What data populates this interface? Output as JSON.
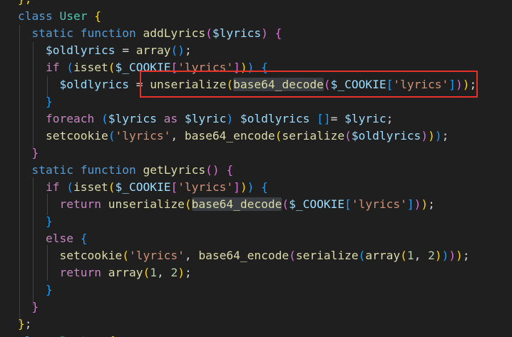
{
  "code_lines": [
    [
      {
        "t": "};",
        "c": "b1"
      }
    ],
    [
      {
        "t": "class ",
        "c": "kw"
      },
      {
        "t": "User ",
        "c": "cls"
      },
      {
        "t": "{",
        "c": "b1"
      }
    ],
    [
      {
        "t": "  "
      },
      {
        "t": "static ",
        "c": "kw"
      },
      {
        "t": "function ",
        "c": "kw"
      },
      {
        "t": "addLyrics",
        "c": "fn"
      },
      {
        "t": "(",
        "c": "b2"
      },
      {
        "t": "$lyrics",
        "c": "var"
      },
      {
        "t": ") ",
        "c": "b2"
      },
      {
        "t": "{",
        "c": "b2"
      }
    ],
    [
      {
        "t": "    "
      },
      {
        "t": "$oldlyrics",
        "c": "var"
      },
      {
        "t": " = "
      },
      {
        "t": "array",
        "c": "fn"
      },
      {
        "t": "()",
        "c": "b3"
      },
      {
        "t": ";"
      }
    ],
    [
      {
        "t": "    "
      },
      {
        "t": "if ",
        "c": "ctl"
      },
      {
        "t": "(",
        "c": "b3"
      },
      {
        "t": "isset",
        "c": "fn"
      },
      {
        "t": "(",
        "c": "b1"
      },
      {
        "t": "$_COOKIE",
        "c": "var"
      },
      {
        "t": "[",
        "c": "b2"
      },
      {
        "t": "'lyrics'",
        "c": "str"
      },
      {
        "t": "]",
        "c": "b2"
      },
      {
        "t": ")",
        "c": "b1"
      },
      {
        "t": ") ",
        "c": "b3"
      },
      {
        "t": "{",
        "c": "b3"
      }
    ],
    [
      {
        "t": "      "
      },
      {
        "t": "$oldlyrics",
        "c": "var"
      },
      {
        "t": " = "
      },
      {
        "t": "unserialize",
        "c": "fn"
      },
      {
        "t": "(",
        "c": "b1"
      },
      {
        "t": "base64_decode",
        "c": "fn",
        "hl": true
      },
      {
        "t": "(",
        "c": "b2"
      },
      {
        "t": "$_COOKIE",
        "c": "var"
      },
      {
        "t": "[",
        "c": "b3"
      },
      {
        "t": "'lyrics'",
        "c": "str"
      },
      {
        "t": "]",
        "c": "b3"
      },
      {
        "t": ")",
        "c": "b2"
      },
      {
        "t": ")",
        "c": "b1"
      },
      {
        "t": ";"
      }
    ],
    [
      {
        "t": "    "
      },
      {
        "t": "}",
        "c": "b3"
      }
    ],
    [
      {
        "t": "    "
      },
      {
        "t": "foreach ",
        "c": "ctl"
      },
      {
        "t": "(",
        "c": "b3"
      },
      {
        "t": "$lyrics",
        "c": "var"
      },
      {
        "t": " as ",
        "c": "ctl"
      },
      {
        "t": "$lyric",
        "c": "var"
      },
      {
        "t": ") ",
        "c": "b3"
      },
      {
        "t": "$oldlyrics",
        "c": "var"
      },
      {
        "t": " "
      },
      {
        "t": "[]",
        "c": "b3"
      },
      {
        "t": "= "
      },
      {
        "t": "$lyric",
        "c": "var"
      },
      {
        "t": ";"
      }
    ],
    [
      {
        "t": "    "
      },
      {
        "t": "setcookie",
        "c": "fn"
      },
      {
        "t": "(",
        "c": "b3"
      },
      {
        "t": "'lyrics'",
        "c": "str"
      },
      {
        "t": ", "
      },
      {
        "t": "base64_encode",
        "c": "fn"
      },
      {
        "t": "(",
        "c": "b1"
      },
      {
        "t": "serialize",
        "c": "fn"
      },
      {
        "t": "(",
        "c": "b2"
      },
      {
        "t": "$oldlyrics",
        "c": "var"
      },
      {
        "t": ")",
        "c": "b2"
      },
      {
        "t": ")",
        "c": "b1"
      },
      {
        "t": ")",
        "c": "b3"
      },
      {
        "t": ";"
      }
    ],
    [
      {
        "t": "  "
      },
      {
        "t": "}",
        "c": "b2"
      }
    ],
    [
      {
        "t": "  "
      },
      {
        "t": "static ",
        "c": "kw"
      },
      {
        "t": "function ",
        "c": "kw"
      },
      {
        "t": "getLyrics",
        "c": "fn"
      },
      {
        "t": "() ",
        "c": "b2"
      },
      {
        "t": "{",
        "c": "b2"
      }
    ],
    [
      {
        "t": "    "
      },
      {
        "t": "if ",
        "c": "ctl"
      },
      {
        "t": "(",
        "c": "b3"
      },
      {
        "t": "isset",
        "c": "fn"
      },
      {
        "t": "(",
        "c": "b1"
      },
      {
        "t": "$_COOKIE",
        "c": "var"
      },
      {
        "t": "[",
        "c": "b2"
      },
      {
        "t": "'lyrics'",
        "c": "str"
      },
      {
        "t": "]",
        "c": "b2"
      },
      {
        "t": ")",
        "c": "b1"
      },
      {
        "t": ") ",
        "c": "b3"
      },
      {
        "t": "{",
        "c": "b3"
      }
    ],
    [
      {
        "t": "      "
      },
      {
        "t": "return ",
        "c": "ctl"
      },
      {
        "t": "unserialize",
        "c": "fn"
      },
      {
        "t": "(",
        "c": "b1"
      },
      {
        "t": "base64_decode",
        "c": "fn",
        "hl": true
      },
      {
        "t": "(",
        "c": "b2"
      },
      {
        "t": "$_COOKIE",
        "c": "var"
      },
      {
        "t": "[",
        "c": "b3"
      },
      {
        "t": "'lyrics'",
        "c": "str"
      },
      {
        "t": "]",
        "c": "b3"
      },
      {
        "t": ")",
        "c": "b2"
      },
      {
        "t": ")",
        "c": "b1"
      },
      {
        "t": ";"
      }
    ],
    [
      {
        "t": "    "
      },
      {
        "t": "}",
        "c": "b3"
      }
    ],
    [
      {
        "t": "    "
      },
      {
        "t": "else ",
        "c": "ctl"
      },
      {
        "t": "{",
        "c": "b3"
      }
    ],
    [
      {
        "t": "      "
      },
      {
        "t": "setcookie",
        "c": "fn"
      },
      {
        "t": "(",
        "c": "b1"
      },
      {
        "t": "'lyrics'",
        "c": "str"
      },
      {
        "t": ", "
      },
      {
        "t": "base64_encode",
        "c": "fn"
      },
      {
        "t": "(",
        "c": "b2"
      },
      {
        "t": "serialize",
        "c": "fn"
      },
      {
        "t": "(",
        "c": "b3"
      },
      {
        "t": "array",
        "c": "fn"
      },
      {
        "t": "(",
        "c": "b1"
      },
      {
        "t": "1",
        "c": "num"
      },
      {
        "t": ", "
      },
      {
        "t": "2",
        "c": "num"
      },
      {
        "t": ")",
        "c": "b1"
      },
      {
        "t": ")",
        "c": "b3"
      },
      {
        "t": ")",
        "c": "b2"
      },
      {
        "t": ")",
        "c": "b1"
      },
      {
        "t": ";"
      }
    ],
    [
      {
        "t": "      "
      },
      {
        "t": "return ",
        "c": "ctl"
      },
      {
        "t": "array",
        "c": "fn"
      },
      {
        "t": "(",
        "c": "b1"
      },
      {
        "t": "1",
        "c": "num"
      },
      {
        "t": ", "
      },
      {
        "t": "2",
        "c": "num"
      },
      {
        "t": ")",
        "c": "b1"
      },
      {
        "t": ";"
      }
    ],
    [
      {
        "t": "    "
      },
      {
        "t": "}",
        "c": "b3"
      }
    ],
    [
      {
        "t": "  "
      },
      {
        "t": "}",
        "c": "b2"
      }
    ],
    [
      {
        "t": "}",
        "c": "b1"
      },
      {
        "t": ";"
      }
    ],
    [
      {
        "t": "class ",
        "c": "kw"
      },
      {
        "t": "Pepton ",
        "c": "cls"
      },
      {
        "t": "{",
        "c": "b1"
      }
    ]
  ],
  "highlight_color": "#e5332a",
  "background_color": "#1f1f1f"
}
